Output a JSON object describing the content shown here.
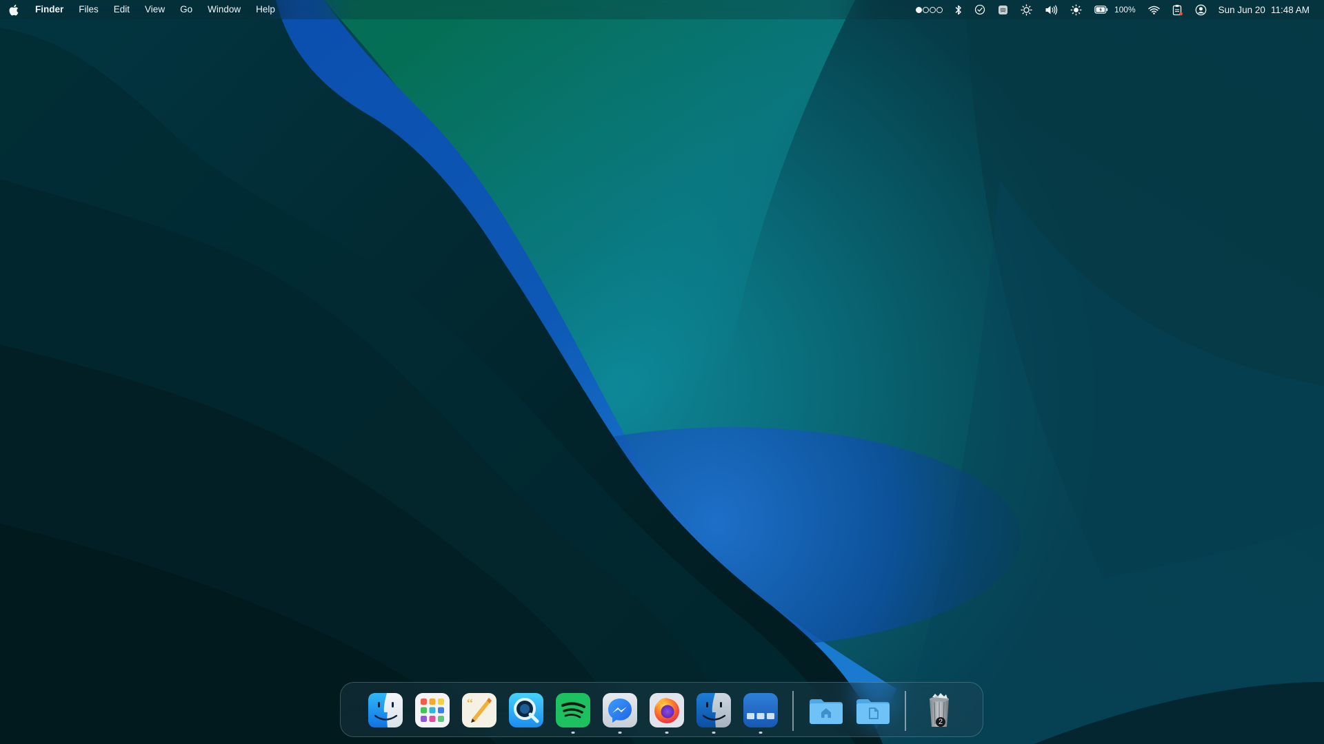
{
  "menubar": {
    "apple_icon": "apple-logo-icon",
    "app_name": "Finder",
    "menus": [
      "Files",
      "Edit",
      "View",
      "Go",
      "Window",
      "Help"
    ],
    "status": {
      "spaces_indicator": {
        "filled": 1,
        "total": 4
      },
      "battery_percent": "100%",
      "date": "Sun Jun 20",
      "time": "11:48 AM"
    }
  },
  "dock": {
    "apps": [
      {
        "name": "Finder",
        "icon": "finder-icon",
        "running": false
      },
      {
        "name": "Launchpad",
        "icon": "launchpad-icon",
        "running": false
      },
      {
        "name": "Script Editor",
        "icon": "script-editor-icon",
        "running": false
      },
      {
        "name": "QuickTime Player",
        "icon": "quicktime-icon",
        "running": false
      },
      {
        "name": "Spotify",
        "icon": "spotify-icon",
        "running": true
      },
      {
        "name": "Messenger",
        "icon": "messenger-icon",
        "running": true
      },
      {
        "name": "Firefox",
        "icon": "firefox-icon",
        "running": true
      },
      {
        "name": "Finder",
        "icon": "finder-icon",
        "running": true
      },
      {
        "name": "Mission Control",
        "icon": "mission-control-icon",
        "running": true
      }
    ],
    "folders": [
      {
        "name": "Home",
        "icon": "home-folder-icon"
      },
      {
        "name": "Documents",
        "icon": "documents-folder-icon"
      }
    ],
    "trash": {
      "icon": "trash-icon",
      "badge": "2"
    }
  },
  "colors": {
    "wallpaper_dark": "#02252c",
    "wallpaper_teal": "#0a7d86",
    "wallpaper_blue": "#0b4fa6",
    "wallpaper_green": "#0a6a5a"
  }
}
